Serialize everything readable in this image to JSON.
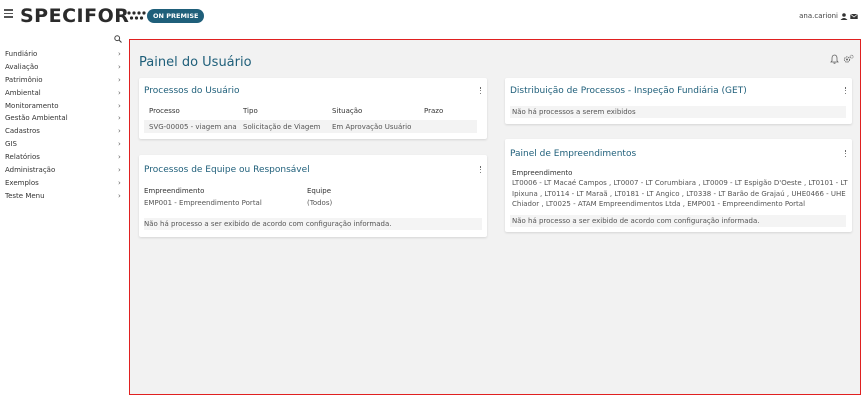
{
  "header": {
    "logo_text": "SPECIFOR",
    "badge": "ON PREMISE",
    "user_name": "ana.carioni"
  },
  "sidebar": {
    "items": [
      {
        "label": "Fundiário"
      },
      {
        "label": "Avaliação"
      },
      {
        "label": "Patrimônio"
      },
      {
        "label": "Ambiental"
      },
      {
        "label": "Monitoramento"
      },
      {
        "label": "Gestão Ambiental"
      },
      {
        "label": "Cadastros"
      },
      {
        "label": "GIS"
      },
      {
        "label": "Relatórios"
      },
      {
        "label": "Administração"
      },
      {
        "label": "Exemplos"
      },
      {
        "label": "Teste Menu"
      }
    ]
  },
  "main": {
    "title": "Painel do Usuário",
    "user_processes": {
      "title": "Processos do Usuário",
      "columns": [
        "Processo",
        "Tipo",
        "Situação",
        "Prazo"
      ],
      "rows": [
        [
          "SVG-00005 - viagem ana",
          "Solicitação de Viagem",
          "Em Aprovação Usuário",
          ""
        ]
      ]
    },
    "team_processes": {
      "title": "Processos de Equipe ou Responsável",
      "enterprise_label": "Empreendimento",
      "enterprise_value": "EMP001 - Empreendimento Portal",
      "team_label": "Equipe",
      "team_value": "(Todos)",
      "message": "Não há processo a ser exibido de acordo com configuração informada."
    },
    "distribution": {
      "title": "Distribuição de Processos - Inspeção Fundiária (GET)",
      "message": "Não há processos a serem exibidos"
    },
    "enterprises_panel": {
      "title": "Painel de Empreendimentos",
      "label": "Empreendimento",
      "list_text": "LT0006 - LT Macaé Campos , LT0007 - LT Corumbiara , LT0009 - LT Espigão D'Oeste , LT0101 - LT Ipixuna , LT0114 - LT Maraã , LT0181 - LT Angico , LT0338 - LT Barão de Grajaú , UHE0466 - UHE Chiador , LT0025 - ATAM Empreendimentos Ltda , EMP001 - Empreendimento Portal",
      "message": "Não há processo a ser exibido de acordo com configuração informada."
    }
  },
  "colors": {
    "accent": "#1f5f7a",
    "frame_border": "#e02020"
  }
}
